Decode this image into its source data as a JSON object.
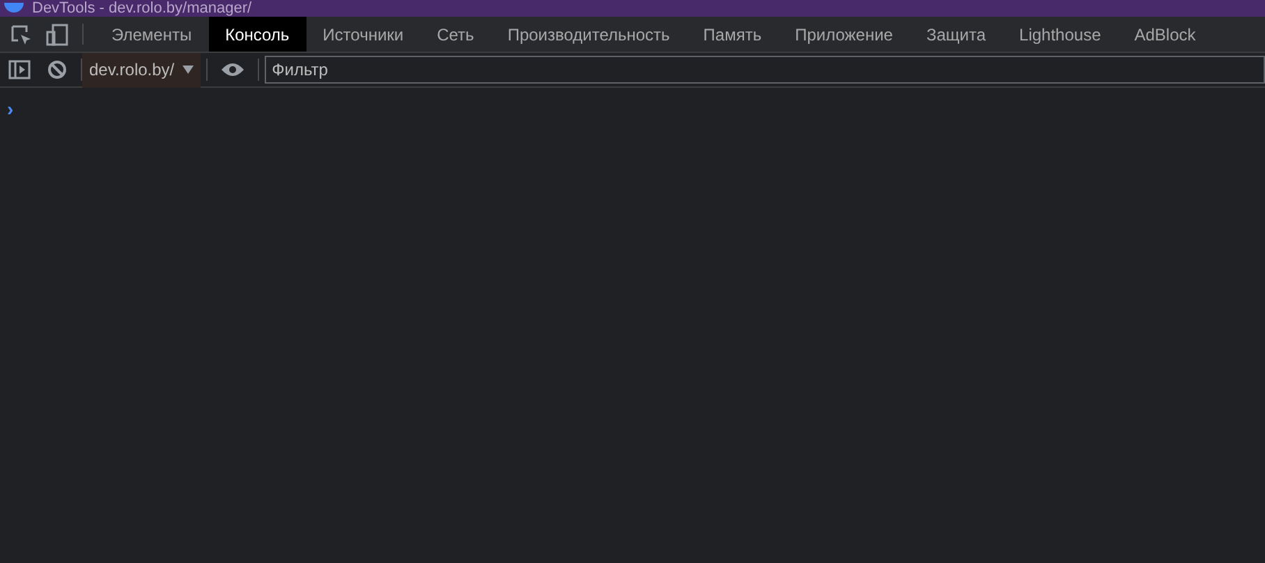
{
  "window": {
    "title": "DevTools - dev.rolo.by/manager/"
  },
  "tabs": [
    {
      "label": "Элементы",
      "selected": false
    },
    {
      "label": "Консоль",
      "selected": true
    },
    {
      "label": "Источники",
      "selected": false
    },
    {
      "label": "Сеть",
      "selected": false
    },
    {
      "label": "Производительность",
      "selected": false
    },
    {
      "label": "Память",
      "selected": false
    },
    {
      "label": "Приложение",
      "selected": false
    },
    {
      "label": "Защита",
      "selected": false
    },
    {
      "label": "Lighthouse",
      "selected": false
    },
    {
      "label": "AdBlock",
      "selected": false
    }
  ],
  "toolbar": {
    "context": "dev.rolo.by/",
    "filter": {
      "placeholder": "Фильтр"
    }
  },
  "console": {
    "prompt": "›"
  }
}
